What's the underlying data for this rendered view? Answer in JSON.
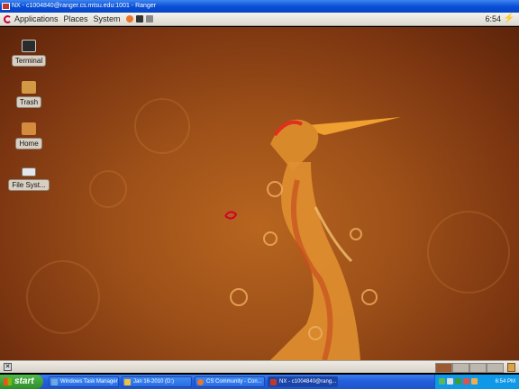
{
  "window": {
    "title": "NX - c1004840@ranger.cs.mtsu.edu:1001 - Ranger"
  },
  "top_panel": {
    "menus": [
      "Applications",
      "Places",
      "System"
    ],
    "clock": "6:54"
  },
  "desktop_icons": [
    {
      "label": "Terminal",
      "icon": "terminal-icon",
      "color": "#2b2b2b"
    },
    {
      "label": "Trash",
      "icon": "trash-icon",
      "color": "#d39a45"
    },
    {
      "label": "Home",
      "icon": "home-folder-icon",
      "color": "#d58b3d"
    },
    {
      "label": "File Syst...",
      "icon": "drive-icon",
      "color": "#e6e6e6"
    }
  ],
  "bottom_panel": {
    "workspaces": 4,
    "active_workspace": 1
  },
  "taskbar": {
    "start_label": "start",
    "buttons": [
      {
        "label": "Windows Task Manager",
        "icon": "task-manager-icon",
        "color": "#6fa8dc"
      },
      {
        "label": "Jan 16-2010 (D:)",
        "icon": "drive-icon",
        "color": "#f0c040"
      },
      {
        "label": "CS Community - Con...",
        "icon": "firefox-icon",
        "color": "#e8762c"
      },
      {
        "label": "NX - c1004840@rang...",
        "icon": "nx-icon",
        "color": "#c0392b"
      }
    ],
    "tray_time": "6:54 PM"
  }
}
